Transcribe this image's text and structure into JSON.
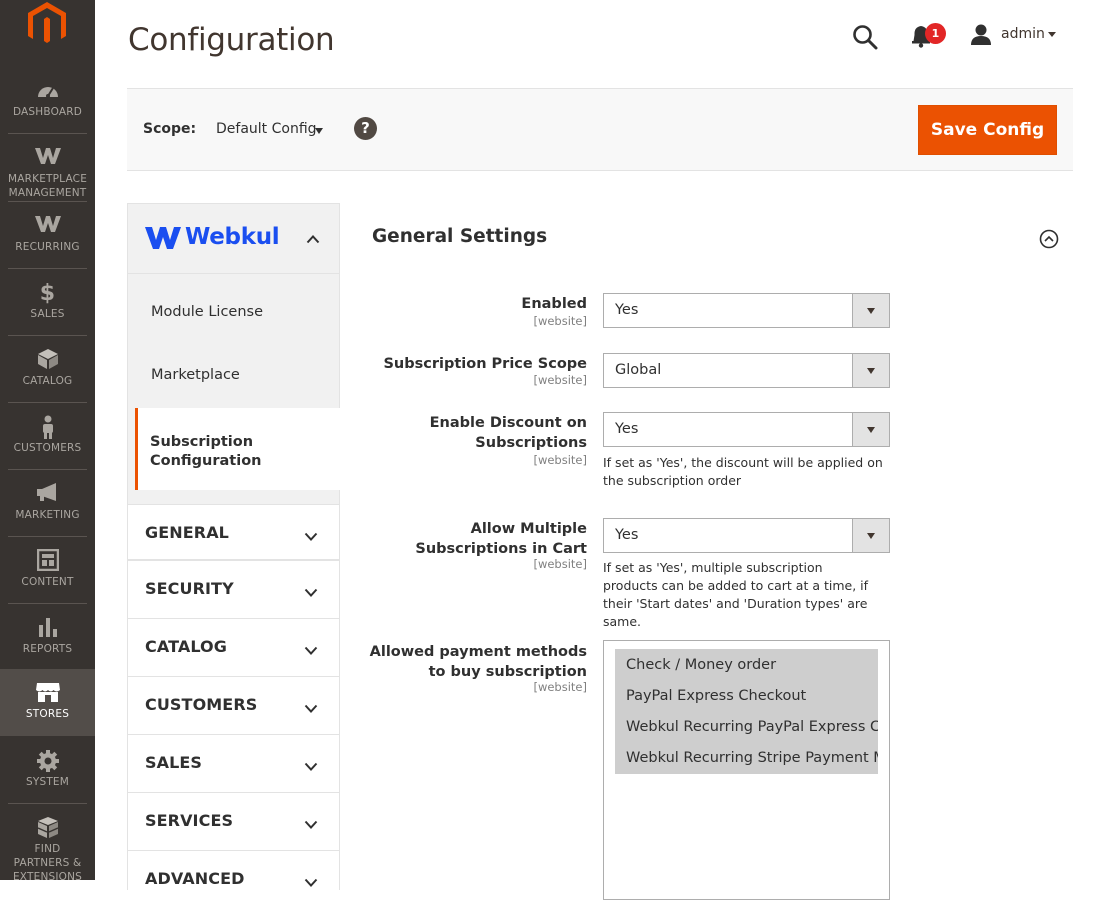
{
  "nav": {
    "items": [
      {
        "label": "DASHBOARD",
        "icon": "dashboard-icon"
      },
      {
        "label": "MARKETPLACE MANAGEMENT",
        "icon": "webkul-w-icon"
      },
      {
        "label": "RECURRING",
        "icon": "webkul-w-icon"
      },
      {
        "label": "SALES",
        "icon": "dollar-icon"
      },
      {
        "label": "CATALOG",
        "icon": "box-icon"
      },
      {
        "label": "CUSTOMERS",
        "icon": "person-icon"
      },
      {
        "label": "MARKETING",
        "icon": "megaphone-icon"
      },
      {
        "label": "CONTENT",
        "icon": "layout-icon"
      },
      {
        "label": "REPORTS",
        "icon": "bar-chart-icon"
      },
      {
        "label": "STORES",
        "icon": "store-icon",
        "active": true
      },
      {
        "label": "SYSTEM",
        "icon": "gear-icon"
      },
      {
        "label": "FIND PARTNERS & EXTENSIONS",
        "icon": "cubes-icon"
      }
    ]
  },
  "header": {
    "title": "Configuration",
    "notification_count": "1",
    "user": "admin"
  },
  "scope": {
    "label": "Scope:",
    "value": "Default Config",
    "help": "?",
    "save_label": "Save Config"
  },
  "sidebar": {
    "brand": "Webkul",
    "sub_items": [
      "Module License",
      "Marketplace"
    ],
    "active_item": "Subscription Configuration",
    "groups": [
      "GENERAL",
      "SECURITY",
      "CATALOG",
      "CUSTOMERS",
      "SALES",
      "SERVICES",
      "ADVANCED"
    ]
  },
  "section": {
    "title": "General Settings",
    "fields": [
      {
        "label": "Enabled",
        "scope": "[website]",
        "value": "Yes",
        "note": ""
      },
      {
        "label": "Subscription Price Scope",
        "scope": "[website]",
        "value": "Global",
        "note": ""
      },
      {
        "label": "Enable Discount on Subscriptions",
        "scope": "[website]",
        "value": "Yes",
        "note": "If set as 'Yes', the discount will be applied on the subscription order"
      },
      {
        "label": "Allow Multiple Subscriptions in Cart",
        "scope": "[website]",
        "value": "Yes",
        "note": "If set as 'Yes', multiple subscription products can be added to cart at a time, if their 'Start dates' and 'Duration types' are same."
      },
      {
        "label": "Allowed payment methods to buy subscription",
        "scope": "[website]"
      }
    ],
    "payment_methods": [
      "Check / Money order",
      "PayPal Express Checkout",
      "Webkul Recurring PayPal Express Checkout",
      "Webkul Recurring Stripe Payment Method"
    ]
  },
  "colors": {
    "nav_bg": "#373330",
    "nav_active": "#524d49",
    "accent": "#eb5202",
    "webkul_blue": "#1a4ef0",
    "badge": "#e22626"
  }
}
